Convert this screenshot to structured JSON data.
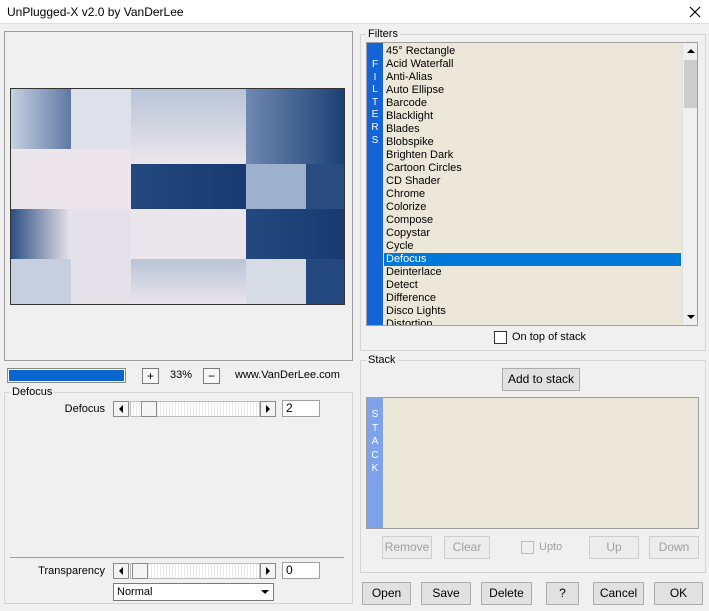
{
  "window": {
    "title": "UnPlugged-X v2.0 by VanDerLee"
  },
  "preview": {
    "progress_fraction": 1.0,
    "zoom_in_label": "+",
    "zoom_value": "33%",
    "zoom_out_label": "−",
    "website": "www.VanDerLee.com"
  },
  "settings": {
    "legend": "Defocus",
    "param_label": "Defocus",
    "param_value": "2",
    "param_position_fraction": 0.08,
    "transparency_label": "Transparency",
    "transparency_value": "0",
    "transparency_position_fraction": 0.0,
    "blend_mode": "Normal"
  },
  "filters": {
    "legend": "Filters",
    "vertical_letters": [
      "F",
      "I",
      "L",
      "T",
      "E",
      "R",
      "S"
    ],
    "items": [
      "45° Rectangle",
      "Acid Waterfall",
      "Anti-Alias",
      "Auto Ellipse",
      "Barcode",
      "Blacklight",
      "Blades",
      "Blobspike",
      "Brighten Dark",
      "Cartoon Circles",
      "CD Shader",
      "Chrome",
      "Colorize",
      "Compose",
      "Copystar",
      "Cycle",
      "Defocus",
      "Deinterlace",
      "Detect",
      "Difference",
      "Disco Lights",
      "Distortion"
    ],
    "selected_index": 16,
    "on_top_label": "On top of stack"
  },
  "stack": {
    "legend": "Stack",
    "add_label": "Add to stack",
    "vertical_letters": [
      "S",
      "T",
      "A",
      "C",
      "K"
    ],
    "remove_label": "Remove",
    "clear_label": "Clear",
    "upto_label": "Upto",
    "up_label": "Up",
    "down_label": "Down"
  },
  "buttons": {
    "open": "Open",
    "save": "Save",
    "delete": "Delete",
    "help": "?",
    "cancel": "Cancel",
    "ok": "OK"
  },
  "colors": {
    "accent": "#0078d7",
    "filters_strip": "#1464d7",
    "stack_strip": "#7ea3ea",
    "list_bg": "#ebe8da"
  }
}
